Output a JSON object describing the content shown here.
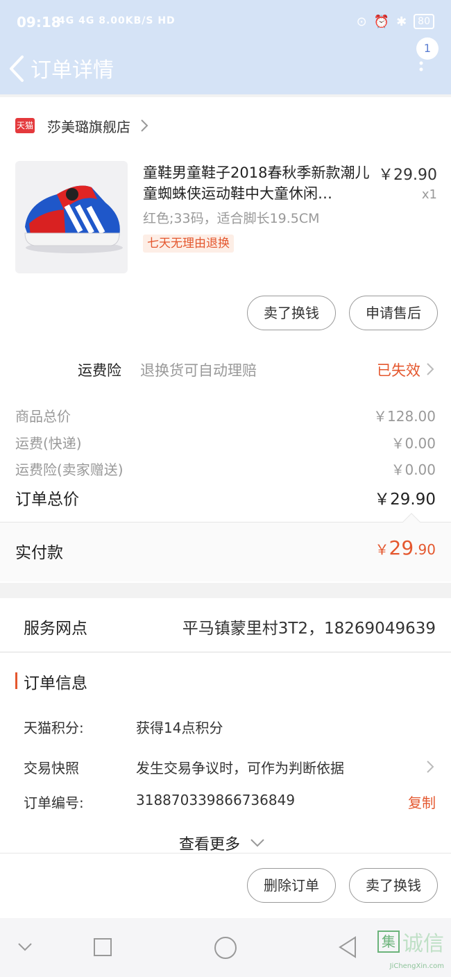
{
  "status_bar": {
    "time": "09:18",
    "network": "4G 4G 8.00KB/S HD",
    "battery": "80"
  },
  "header": {
    "title": "订单详情",
    "notification_count": "1"
  },
  "store": {
    "badge": "天猫",
    "name": "莎美璐旗舰店"
  },
  "product": {
    "title": "童鞋男童鞋子2018春秋季新款潮儿童蜘蛛侠运动鞋中大童休闲…",
    "price": "￥29.90",
    "quantity": "x1",
    "spec": "红色;33码，适合脚长19.5CM",
    "tag": "七天无理由退换"
  },
  "product_actions": {
    "sell_button": "卖了换钱",
    "after_sale_button": "申请售后"
  },
  "shipping_insurance": {
    "label": "运费险",
    "description": "退换货可自动理赔",
    "status": "已失效"
  },
  "costs": [
    {
      "label": "商品总价",
      "value": "￥128.00"
    },
    {
      "label": "运费(快递)",
      "value": "￥0.00"
    },
    {
      "label": "运费险(卖家赠送)",
      "value": "￥0.00"
    }
  ],
  "order_total": {
    "label": "订单总价",
    "value": "￥29.90"
  },
  "paid": {
    "label": "实付款",
    "currency": "￥",
    "integer": "29",
    "decimal": ".90"
  },
  "service_point": {
    "label": "服务网点",
    "value": "平马镇蒙里村3T2，18269049639"
  },
  "order_info": {
    "heading": "订单信息",
    "rows": [
      {
        "key": "天猫积分:",
        "value": "获得14点积分"
      },
      {
        "key": "交易快照",
        "value": "发生交易争议时，可作为判断依据"
      },
      {
        "key": "订单编号:",
        "value": "318870339866736849",
        "action": "复制"
      }
    ],
    "view_more": "查看更多"
  },
  "footer": {
    "delete_button": "删除订单",
    "sell_button": "卖了换钱"
  },
  "watermark": {
    "logo": "集",
    "text": "诚信",
    "url": "JiChengXin.com"
  },
  "colors": {
    "header_bg": "#d5e3f6",
    "accent": "#e4572e",
    "tmall_red": "#e4393c"
  }
}
